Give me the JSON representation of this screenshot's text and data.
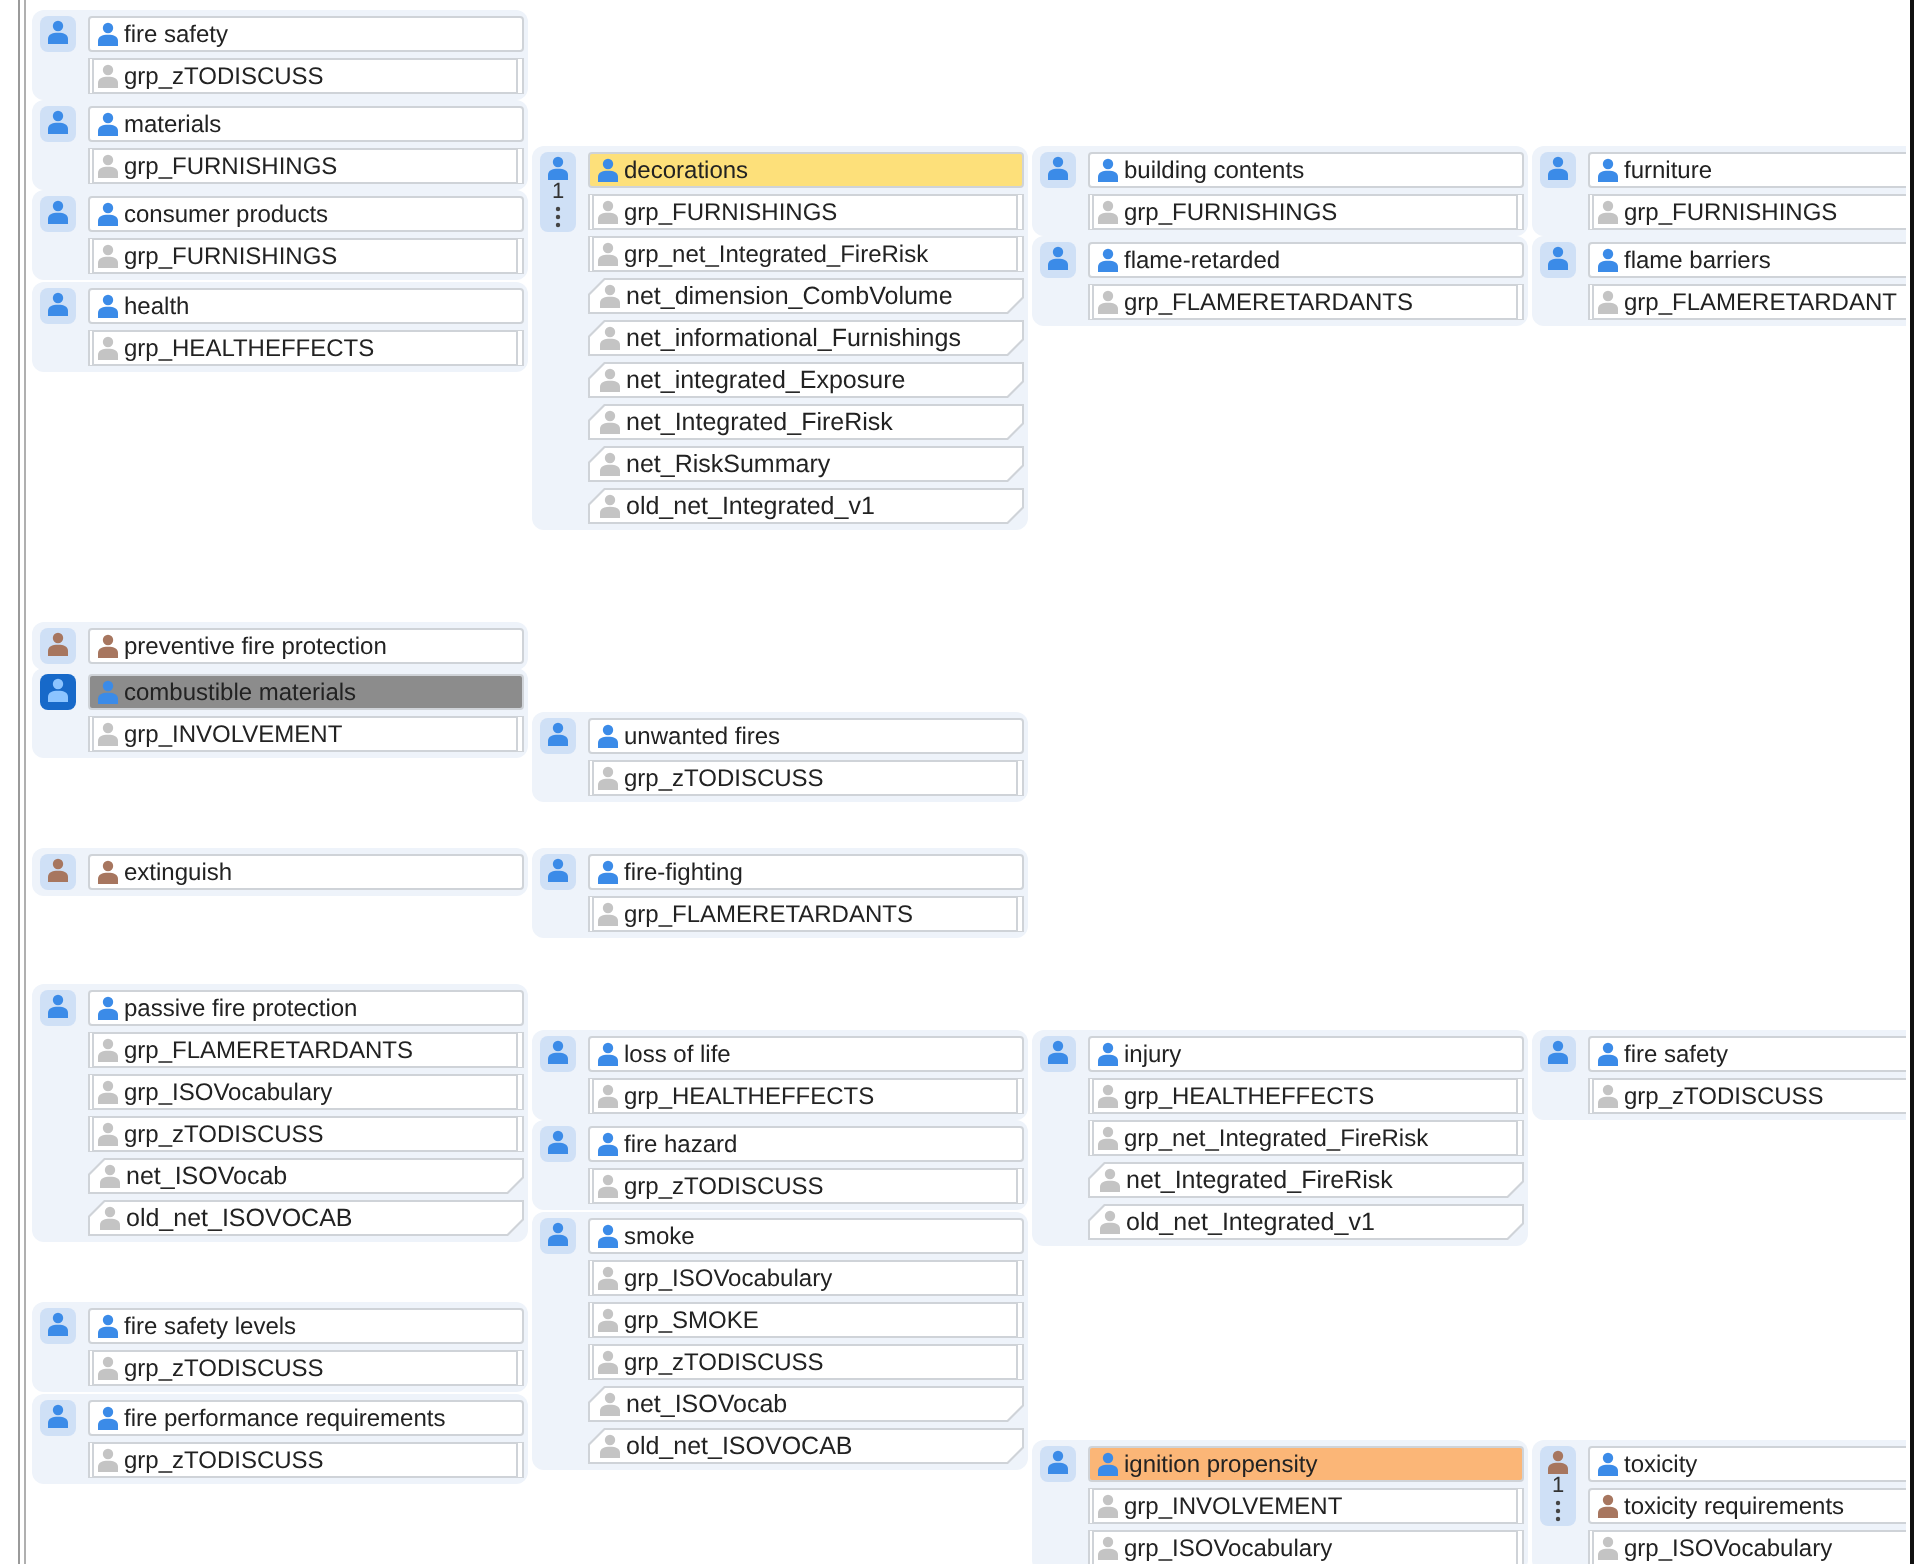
{
  "groups": [
    {
      "kind": "concept",
      "selected": false,
      "entries": [
        {
          "kind": "concept",
          "label": "fire safety"
        },
        {
          "kind": "group",
          "label": "grp_zTODISCUSS"
        }
      ]
    },
    {
      "kind": "concept",
      "selected": false,
      "entries": [
        {
          "kind": "concept",
          "label": "materials"
        },
        {
          "kind": "group",
          "label": "grp_FURNISHINGS"
        }
      ]
    },
    {
      "kind": "concept",
      "selected": false,
      "entries": [
        {
          "kind": "concept",
          "label": "consumer products"
        },
        {
          "kind": "group",
          "label": "grp_FURNISHINGS"
        }
      ]
    },
    {
      "kind": "concept",
      "selected": false,
      "entries": [
        {
          "kind": "concept",
          "label": "health"
        },
        {
          "kind": "group",
          "label": "grp_HEALTHEFFECTS"
        }
      ]
    },
    {
      "kind": "concept",
      "selected": false,
      "counter": "1",
      "entries": [
        {
          "kind": "concept",
          "label": "decorations",
          "color": "#fde07a"
        },
        {
          "kind": "group",
          "label": "grp_FURNISHINGS"
        },
        {
          "kind": "group",
          "label": "grp_net_Integrated_FireRisk"
        },
        {
          "kind": "network",
          "label": "net_dimension_CombVolume"
        },
        {
          "kind": "network",
          "label": "net_informational_Furnishings"
        },
        {
          "kind": "network",
          "label": "net_integrated_Exposure"
        },
        {
          "kind": "network",
          "label": "net_Integrated_FireRisk"
        },
        {
          "kind": "network",
          "label": "net_RiskSummary"
        },
        {
          "kind": "network",
          "label": "old_net_Integrated_v1"
        }
      ]
    },
    {
      "kind": "concept",
      "selected": false,
      "entries": [
        {
          "kind": "concept",
          "label": "building contents"
        },
        {
          "kind": "group",
          "label": "grp_FURNISHINGS"
        }
      ]
    },
    {
      "kind": "concept",
      "selected": false,
      "entries": [
        {
          "kind": "concept",
          "label": "flame-retarded"
        },
        {
          "kind": "group",
          "label": "grp_FLAMERETARDANTS"
        }
      ]
    },
    {
      "kind": "concept",
      "selected": false,
      "entries": [
        {
          "kind": "concept",
          "label": "furniture"
        },
        {
          "kind": "group",
          "label": "grp_FURNISHINGS"
        }
      ]
    },
    {
      "kind": "concept",
      "selected": false,
      "entries": [
        {
          "kind": "concept",
          "label": "flame barriers"
        },
        {
          "kind": "group",
          "label": "grp_FLAMERETARDANT"
        }
      ]
    },
    {
      "kind": "attribute",
      "selected": false,
      "entries": [
        {
          "kind": "attribute",
          "label": "preventive fire protection"
        }
      ]
    },
    {
      "kind": "concept",
      "selected": true,
      "entries": [
        {
          "kind": "concept",
          "label": "combustible materials"
        },
        {
          "kind": "group",
          "label": "grp_INVOLVEMENT"
        }
      ]
    },
    {
      "kind": "concept",
      "selected": false,
      "entries": [
        {
          "kind": "concept",
          "label": "unwanted fires"
        },
        {
          "kind": "group",
          "label": "grp_zTODISCUSS"
        }
      ]
    },
    {
      "kind": "attribute",
      "selected": false,
      "entries": [
        {
          "kind": "attribute",
          "label": "extinguish"
        }
      ]
    },
    {
      "kind": "concept",
      "selected": false,
      "entries": [
        {
          "kind": "concept",
          "label": "fire-fighting"
        },
        {
          "kind": "group",
          "label": "grp_FLAMERETARDANTS"
        }
      ]
    },
    {
      "kind": "concept",
      "selected": false,
      "entries": [
        {
          "kind": "concept",
          "label": "passive fire protection"
        },
        {
          "kind": "group",
          "label": "grp_FLAMERETARDANTS"
        },
        {
          "kind": "group",
          "label": "grp_ISOVocabulary"
        },
        {
          "kind": "group",
          "label": "grp_zTODISCUSS"
        },
        {
          "kind": "network",
          "label": "net_ISOVocab"
        },
        {
          "kind": "network",
          "label": "old_net_ISOVOCAB"
        }
      ]
    },
    {
      "kind": "concept",
      "selected": false,
      "entries": [
        {
          "kind": "concept",
          "label": "loss of life"
        },
        {
          "kind": "group",
          "label": "grp_HEALTHEFFECTS"
        }
      ]
    },
    {
      "kind": "concept",
      "selected": false,
      "entries": [
        {
          "kind": "concept",
          "label": "fire hazard"
        },
        {
          "kind": "group",
          "label": "grp_zTODISCUSS"
        }
      ]
    },
    {
      "kind": "concept",
      "selected": false,
      "entries": [
        {
          "kind": "concept",
          "label": "smoke"
        },
        {
          "kind": "group",
          "label": "grp_ISOVocabulary"
        },
        {
          "kind": "group",
          "label": "grp_SMOKE"
        },
        {
          "kind": "group",
          "label": "grp_zTODISCUSS"
        },
        {
          "kind": "network",
          "label": "net_ISOVocab"
        },
        {
          "kind": "network",
          "label": "old_net_ISOVOCAB"
        }
      ]
    },
    {
      "kind": "concept",
      "selected": false,
      "entries": [
        {
          "kind": "concept",
          "label": "injury"
        },
        {
          "kind": "group",
          "label": "grp_HEALTHEFFECTS"
        },
        {
          "kind": "group",
          "label": "grp_net_Integrated_FireRisk"
        },
        {
          "kind": "network",
          "label": "net_Integrated_FireRisk"
        },
        {
          "kind": "network",
          "label": "old_net_Integrated_v1"
        }
      ]
    },
    {
      "kind": "concept",
      "selected": false,
      "entries": [
        {
          "kind": "concept",
          "label": "fire safety"
        },
        {
          "kind": "group",
          "label": "grp_zTODISCUSS"
        }
      ]
    },
    {
      "kind": "concept",
      "selected": false,
      "entries": [
        {
          "kind": "concept",
          "label": "fire safety levels"
        },
        {
          "kind": "group",
          "label": "grp_zTODISCUSS"
        }
      ]
    },
    {
      "kind": "concept",
      "selected": false,
      "entries": [
        {
          "kind": "concept",
          "label": "fire performance requirements"
        },
        {
          "kind": "group",
          "label": "grp_zTODISCUSS"
        }
      ]
    },
    {
      "kind": "concept",
      "selected": false,
      "entries": [
        {
          "kind": "concept",
          "label": "ignition propensity",
          "color": "#fbb677"
        },
        {
          "kind": "group",
          "label": "grp_INVOLVEMENT"
        },
        {
          "kind": "group",
          "label": "grp_ISOVocabulary"
        }
      ]
    },
    {
      "kind": "attribute",
      "selected": false,
      "counter": "1",
      "entries": [
        {
          "kind": "concept",
          "label": "toxicity"
        },
        {
          "kind": "attribute",
          "label": "toxicity requirements"
        },
        {
          "kind": "group",
          "label": "grp_ISOVocabulary"
        }
      ]
    }
  ]
}
